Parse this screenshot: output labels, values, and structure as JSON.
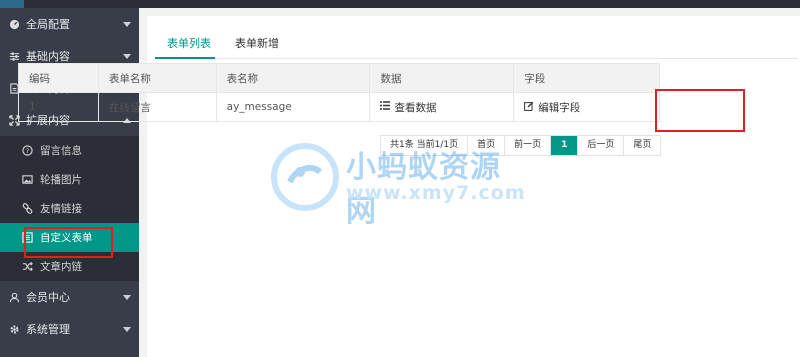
{
  "sidebar": {
    "items": [
      {
        "label": "全局配置",
        "icon": "gauge-icon"
      },
      {
        "label": "基础内容",
        "icon": "sliders-icon"
      },
      {
        "label": "文章内容",
        "icon": "file-icon"
      },
      {
        "label": "扩展内容",
        "icon": "expand-icon",
        "expanded": true
      },
      {
        "label": "会员中心",
        "icon": "user-icon"
      },
      {
        "label": "系统管理",
        "icon": "gear-icon"
      }
    ],
    "submenu": [
      {
        "label": "留言信息",
        "icon": "question-icon"
      },
      {
        "label": "轮播图片",
        "icon": "image-icon"
      },
      {
        "label": "友情链接",
        "icon": "link-icon"
      },
      {
        "label": "自定义表单",
        "icon": "form-icon",
        "active": true
      },
      {
        "label": "文章内链",
        "icon": "shuffle-icon"
      }
    ]
  },
  "tabs": [
    {
      "label": "表单列表",
      "active": true
    },
    {
      "label": "表单新增"
    }
  ],
  "table": {
    "headers": [
      "编码",
      "表单名称",
      "表名称",
      "数据",
      "字段"
    ],
    "rows": [
      {
        "id": "1",
        "name": "在线留言",
        "table": "ay_message",
        "data_action": "查看数据",
        "field_action": "编辑字段"
      }
    ]
  },
  "pager": {
    "info": "共1条 当前1/1页",
    "first": "首页",
    "prev": "前一页",
    "current": "1",
    "next": "后一页",
    "last": "尾页"
  },
  "watermark": {
    "text": "小蚂蚁资源网",
    "url": "www.xmy7.com"
  },
  "colors": {
    "accent": "#009688",
    "sidebar": "#393d49",
    "highlight": "#e02020"
  }
}
